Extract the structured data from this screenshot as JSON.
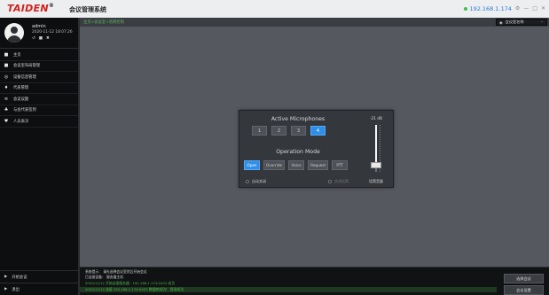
{
  "titlebar": {
    "logo": "TAIDEN",
    "logo_mark": "®",
    "app_title": "会议管理系统",
    "ip": "192.168.1.174",
    "controls": [
      "⚙",
      "—",
      "□",
      "✕"
    ]
  },
  "user": {
    "name": "admin",
    "time": "2020-11-12 18:07:26",
    "icons": [
      "↺",
      "■",
      "✖"
    ]
  },
  "sidebar": {
    "items": [
      {
        "label": "主页",
        "icon": "home-icon",
        "glyph": "■"
      },
      {
        "label": "会议室布局管理",
        "icon": "layout-icon",
        "glyph": "■"
      },
      {
        "label": "设备信息管理",
        "icon": "device-icon",
        "glyph": "◎"
      },
      {
        "label": "代表管理",
        "icon": "delegate-icon",
        "glyph": "♦"
      },
      {
        "label": "会议议题",
        "icon": "agenda-icon",
        "glyph": "≡"
      },
      {
        "label": "与会代表签到",
        "icon": "signin-icon",
        "glyph": "♣"
      },
      {
        "label": "人员表决",
        "icon": "vote-icon",
        "glyph": "♥"
      }
    ],
    "bottom": [
      {
        "label": "开始会议",
        "icon": "play-icon",
        "glyph": "▶"
      },
      {
        "label": "退出",
        "icon": "exit-icon",
        "glyph": "▶"
      }
    ]
  },
  "main": {
    "breadcrumb": "主页>会议室>话筒控制",
    "room_select": "会议室名称",
    "room_icon": "◉",
    "chevron": "⌄"
  },
  "panel": {
    "active_mics_title": "Active Microphones",
    "mic_counts": [
      "1",
      "2",
      "3",
      "4"
    ],
    "active_mic_index": 3,
    "operation_mode_title": "Operation Mode",
    "modes": [
      "Open",
      "Override",
      "Voice",
      "Request",
      "PTT"
    ],
    "active_mode_index": 0,
    "check_left": "自动关闭",
    "check_right": "关闭话筒",
    "fader_value_label": "-21 dB",
    "fader_level": 0.15,
    "fader_caption": "话筒音量"
  },
  "log": {
    "lines": [
      {
        "text": "系统提示：   请先选择会议室然后开始会议",
        "style": "w"
      },
      {
        "text": "已连接设备：  服务器主机",
        "style": "w"
      },
      {
        "text": "2020/11/12   开始连接服务器：192.168.1.174:5432 成功",
        "style": "g"
      },
      {
        "text": "2020/11/12   连接 192.168.1.174:5432 数据库成功！  登录成功",
        "style": "gb"
      }
    ],
    "buttons": [
      "选择会议",
      "会议设置"
    ]
  }
}
